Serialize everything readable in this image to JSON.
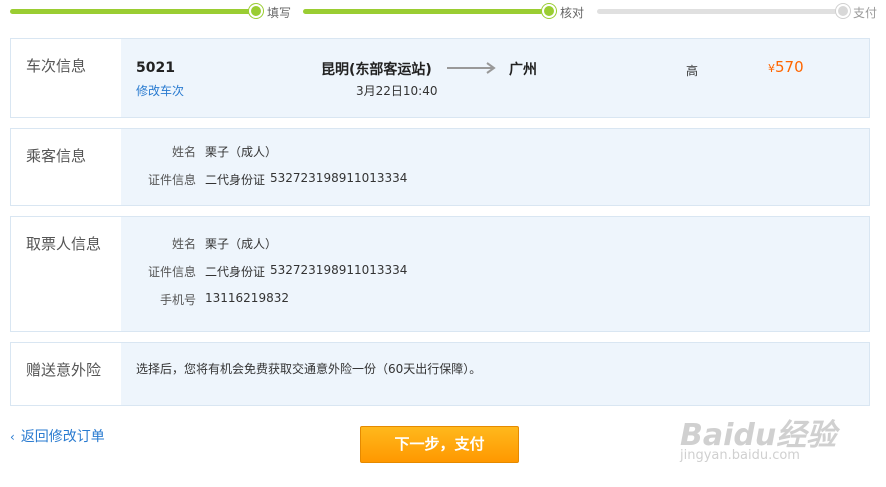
{
  "progress": {
    "steps": [
      {
        "label": "填写",
        "state": "done"
      },
      {
        "label": "核对",
        "state": "current"
      },
      {
        "label": "支付",
        "state": "todo"
      }
    ],
    "colors": {
      "done": "#9acd32",
      "todo": "#e0e0e0"
    }
  },
  "train": {
    "section_title": "车次信息",
    "number": "5021",
    "change_link": "修改车次",
    "from_station": "昆明(东部客运站)",
    "depart_time": "3月22日10:40",
    "to_station": "广州",
    "seat_class": "高",
    "price_symbol": "¥",
    "price": "570"
  },
  "passenger": {
    "section_title": "乘客信息",
    "name_label": "姓名",
    "name_value": "栗子（成人）",
    "id_label": "证件信息",
    "id_type": "二代身份证",
    "id_number": "532723198911013334"
  },
  "collector": {
    "section_title": "取票人信息",
    "name_label": "姓名",
    "name_value": "栗子（成人）",
    "id_label": "证件信息",
    "id_type": "二代身份证",
    "id_number": "532723198911013334",
    "phone_label": "手机号",
    "phone_value": "13116219832"
  },
  "insurance": {
    "section_title": "赠送意外险",
    "text": "选择后，您将有机会免费获取交通意外险一份（60天出行保障）。"
  },
  "actions": {
    "back_label": "返回修改订单",
    "next_label": "下一步，支付"
  },
  "watermark": {
    "logo": "Baidu经验",
    "url": "jingyan.baidu.com"
  },
  "colors": {
    "accent_link": "#2a7bd0",
    "price": "#ff6600",
    "button": "#ff9800",
    "panel_bg": "#eef5fc"
  }
}
